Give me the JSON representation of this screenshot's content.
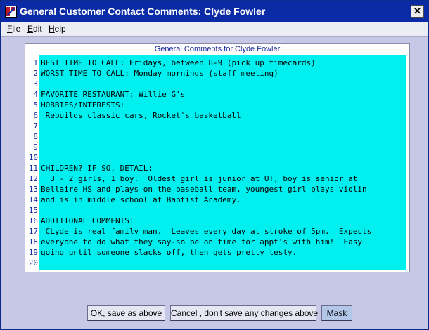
{
  "window": {
    "title": "General Customer Contact Comments:  Clyde Fowler",
    "close_glyph": "✕"
  },
  "menu": {
    "items": [
      {
        "accel": "F",
        "rest": "ile"
      },
      {
        "accel": "E",
        "rest": "dit"
      },
      {
        "accel": "H",
        "rest": "elp"
      }
    ]
  },
  "panel": {
    "header": "General Comments for Clyde Fowler",
    "line_numbers": [
      "1",
      "2",
      "3",
      "4",
      "5",
      "6",
      "7",
      "8",
      "9",
      "10",
      "11",
      "12",
      "13",
      "14",
      "15",
      "16",
      "17",
      "18",
      "19",
      "20"
    ],
    "lines": [
      "BEST TIME TO CALL: Fridays, between 8-9 (pick up timecards)",
      "WORST TIME TO CALL: Monday mornings (staff meeting)",
      "",
      "FAVORITE RESTAURANT: Willie G's",
      "HOBBIES/INTERESTS:",
      " Rebuilds classic cars, Rocket's basketball",
      "",
      "",
      "",
      "",
      "CHILDREN? IF SO, DETAIL:",
      "  3 - 2 girls, 1 boy.  Oldest girl is junior at UT, boy is senior at",
      "Bellaire HS and plays on the baseball team, youngest girl plays violin",
      "and is in middle school at Baptist Academy.",
      "",
      "ADDITIONAL COMMENTS:",
      " CLyde is real family man.  Leaves every day at stroke of 5pm.  Expects",
      "everyone to do what they say-so be on time for appt's with him!  Easy",
      "going until someone slacks off, then gets pretty testy.",
      ""
    ]
  },
  "buttons": {
    "ok": "OK, save as above",
    "cancel": "Cancel , don't save any changes above",
    "mask": "Mask"
  }
}
